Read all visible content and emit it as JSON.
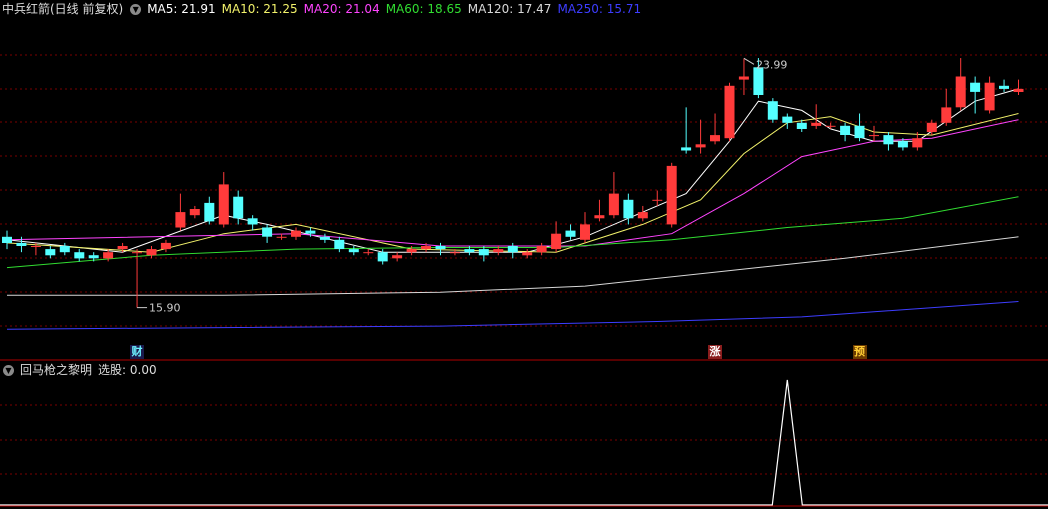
{
  "header": {
    "title": "中兵红箭(日线 前复权)",
    "ma": [
      {
        "label": "MA5: 21.91",
        "color": "#ffffff"
      },
      {
        "label": "MA10: 21.25",
        "color": "#f2f26b"
      },
      {
        "label": "MA20: 21.04",
        "color": "#ff44ff"
      },
      {
        "label": "MA60: 18.65",
        "color": "#31dd31"
      },
      {
        "label": "MA120: 17.47",
        "color": "#d8d8d8"
      },
      {
        "label": "MA250: 15.71",
        "color": "#3d3dff"
      }
    ]
  },
  "indicator": {
    "title": "回马枪之黎明",
    "value": "选股: 0.00"
  },
  "markers": [
    {
      "text": "财",
      "idx": 9,
      "color": "#6cf0ff",
      "bg": "#1a1a4d"
    },
    {
      "text": "涨",
      "idx": 49,
      "color": "#ffffff",
      "bg": "#8a1d1d"
    },
    {
      "text": "预",
      "idx": 59,
      "color": "#ffcc33",
      "bg": "#6b3a00"
    }
  ],
  "annotations": {
    "high": "23.99",
    "low": "15.90"
  },
  "colors": {
    "up": "#ff3b3b",
    "down": "#54ffff",
    "grid": "#7a0000",
    "indicator_line": "#ffffff"
  },
  "chart_data": {
    "type": "candlestick",
    "price_range": [
      14.2,
      25.3
    ],
    "candles": [
      [
        18.2,
        18.0,
        18.4,
        17.8
      ],
      [
        18.0,
        17.9,
        18.2,
        17.7
      ],
      [
        17.9,
        17.9,
        18.0,
        17.6
      ],
      [
        17.8,
        17.6,
        17.9,
        17.5
      ],
      [
        17.9,
        17.7,
        18.0,
        17.6
      ],
      [
        17.7,
        17.5,
        17.8,
        17.4
      ],
      [
        17.6,
        17.5,
        17.7,
        17.4
      ],
      [
        17.5,
        17.7,
        17.8,
        17.4
      ],
      [
        17.8,
        17.9,
        18.0,
        17.7
      ],
      [
        17.7,
        17.7,
        17.8,
        15.9
      ],
      [
        17.6,
        17.8,
        17.9,
        17.5
      ],
      [
        17.8,
        18.0,
        18.1,
        17.7
      ],
      [
        18.5,
        19.0,
        19.6,
        18.4
      ],
      [
        18.9,
        19.1,
        19.2,
        18.8
      ],
      [
        19.3,
        18.7,
        19.5,
        18.6
      ],
      [
        18.6,
        19.9,
        20.3,
        18.5
      ],
      [
        19.5,
        18.8,
        19.7,
        18.6
      ],
      [
        18.8,
        18.6,
        18.9,
        18.4
      ],
      [
        18.5,
        18.2,
        18.6,
        18.0
      ],
      [
        18.2,
        18.2,
        18.3,
        18.1
      ],
      [
        18.2,
        18.4,
        18.5,
        18.1
      ],
      [
        18.4,
        18.3,
        18.5,
        18.2
      ],
      [
        18.2,
        18.1,
        18.3,
        18.0
      ],
      [
        18.1,
        17.8,
        18.2,
        17.7
      ],
      [
        17.8,
        17.7,
        17.9,
        17.6
      ],
      [
        17.7,
        17.7,
        17.8,
        17.6
      ],
      [
        17.7,
        17.4,
        17.8,
        17.3
      ],
      [
        17.5,
        17.6,
        17.7,
        17.4
      ],
      [
        17.7,
        17.8,
        17.9,
        17.6
      ],
      [
        17.8,
        17.9,
        18.0,
        17.7
      ],
      [
        17.9,
        17.8,
        18.0,
        17.6
      ],
      [
        17.7,
        17.7,
        17.8,
        17.6
      ],
      [
        17.8,
        17.7,
        17.9,
        17.6
      ],
      [
        17.8,
        17.6,
        17.9,
        17.4
      ],
      [
        17.7,
        17.8,
        17.9,
        17.6
      ],
      [
        17.9,
        17.7,
        18.0,
        17.5
      ],
      [
        17.6,
        17.7,
        17.8,
        17.5
      ],
      [
        17.7,
        17.9,
        18.0,
        17.6
      ],
      [
        17.8,
        18.3,
        18.7,
        17.7
      ],
      [
        18.4,
        18.2,
        18.6,
        18.1
      ],
      [
        18.1,
        18.6,
        19.0,
        18.0
      ],
      [
        18.8,
        18.9,
        19.4,
        18.7
      ],
      [
        18.9,
        19.6,
        20.3,
        18.8
      ],
      [
        19.4,
        18.8,
        19.6,
        18.6
      ],
      [
        18.8,
        19.0,
        19.2,
        18.7
      ],
      [
        19.4,
        19.4,
        19.7,
        19.2
      ],
      [
        18.6,
        20.5,
        20.6,
        18.5
      ],
      [
        21.1,
        21.0,
        22.4,
        20.9
      ],
      [
        21.1,
        21.2,
        22.0,
        20.9
      ],
      [
        21.3,
        21.5,
        22.2,
        21.2
      ],
      [
        21.4,
        23.1,
        23.2,
        21.3
      ],
      [
        23.3,
        23.4,
        23.99,
        22.8
      ],
      [
        23.7,
        22.8,
        24.0,
        22.7
      ],
      [
        22.6,
        22.0,
        22.7,
        21.9
      ],
      [
        22.1,
        21.9,
        22.2,
        21.7
      ],
      [
        21.9,
        21.7,
        22.0,
        21.6
      ],
      [
        21.8,
        21.9,
        22.5,
        21.7
      ],
      [
        21.8,
        21.8,
        21.9,
        21.7
      ],
      [
        21.8,
        21.5,
        21.9,
        21.3
      ],
      [
        21.8,
        21.4,
        22.2,
        21.3
      ],
      [
        21.5,
        21.5,
        21.8,
        21.3
      ],
      [
        21.5,
        21.2,
        21.6,
        21.0
      ],
      [
        21.3,
        21.1,
        21.4,
        21.0
      ],
      [
        21.1,
        21.4,
        21.6,
        21.0
      ],
      [
        21.6,
        21.9,
        22.0,
        21.5
      ],
      [
        21.9,
        22.4,
        23.0,
        21.8
      ],
      [
        22.4,
        23.4,
        24.0,
        22.3
      ],
      [
        23.2,
        22.9,
        23.4,
        22.2
      ],
      [
        22.3,
        23.2,
        23.4,
        22.2
      ],
      [
        23.1,
        23.0,
        23.3,
        22.9
      ],
      [
        22.9,
        23.0,
        23.3,
        22.8
      ]
    ],
    "ma": {
      "MA5": [
        [
          0,
          18.1
        ],
        [
          8,
          17.7
        ],
        [
          15,
          18.9
        ],
        [
          18,
          18.6
        ],
        [
          26,
          17.7
        ],
        [
          36,
          17.7
        ],
        [
          40,
          18.2
        ],
        [
          44,
          19.0
        ],
        [
          47,
          19.6
        ],
        [
          50,
          21.3
        ],
        [
          52,
          22.6
        ],
        [
          55,
          22.3
        ],
        [
          57,
          21.7
        ],
        [
          60,
          21.3
        ],
        [
          63,
          21.3
        ],
        [
          67,
          22.6
        ],
        [
          70,
          23.0
        ]
      ],
      "MA10": [
        [
          0,
          18.0
        ],
        [
          10,
          17.7
        ],
        [
          15,
          18.3
        ],
        [
          20,
          18.6
        ],
        [
          28,
          17.8
        ],
        [
          38,
          17.7
        ],
        [
          44,
          18.6
        ],
        [
          48,
          19.4
        ],
        [
          51,
          20.9
        ],
        [
          54,
          21.9
        ],
        [
          57,
          22.1
        ],
        [
          60,
          21.6
        ],
        [
          64,
          21.5
        ],
        [
          70,
          22.2
        ]
      ],
      "MA20": [
        [
          0,
          18.1
        ],
        [
          20,
          18.3
        ],
        [
          30,
          17.9
        ],
        [
          40,
          17.9
        ],
        [
          46,
          18.3
        ],
        [
          51,
          19.6
        ],
        [
          55,
          20.8
        ],
        [
          60,
          21.3
        ],
        [
          64,
          21.4
        ],
        [
          70,
          22.0
        ]
      ],
      "MA60": [
        [
          0,
          17.2
        ],
        [
          10,
          17.6
        ],
        [
          20,
          17.8
        ],
        [
          30,
          17.85
        ],
        [
          38,
          17.85
        ],
        [
          46,
          18.1
        ],
        [
          54,
          18.5
        ],
        [
          62,
          18.8
        ],
        [
          70,
          19.5
        ]
      ],
      "MA120": [
        [
          0,
          16.3
        ],
        [
          15,
          16.3
        ],
        [
          30,
          16.4
        ],
        [
          40,
          16.6
        ],
        [
          50,
          17.1
        ],
        [
          58,
          17.5
        ],
        [
          70,
          18.2
        ]
      ],
      "MA250": [
        [
          0,
          15.2
        ],
        [
          15,
          15.25
        ],
        [
          30,
          15.3
        ],
        [
          45,
          15.45
        ],
        [
          55,
          15.6
        ],
        [
          70,
          16.1
        ]
      ]
    },
    "indicator": {
      "type": "line",
      "range": [
        0,
        1
      ],
      "spike_index": 54,
      "spike_value": 1
    }
  }
}
